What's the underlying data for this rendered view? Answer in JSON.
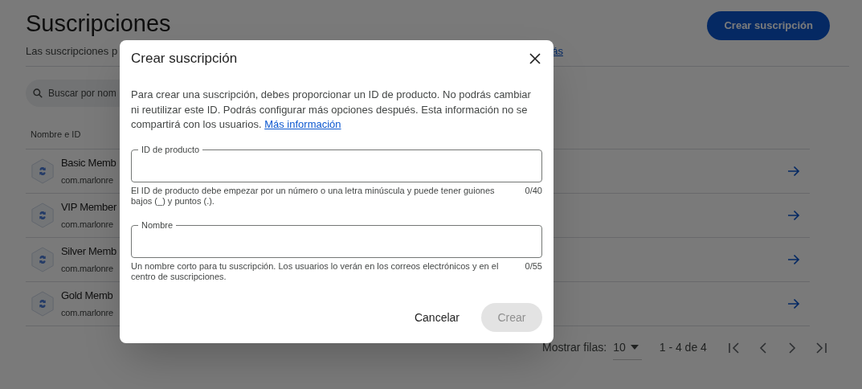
{
  "page": {
    "title": "Suscripciones",
    "subtitle": "Las suscripciones p",
    "subtitle_link": "ás",
    "create_button": "Crear suscripción",
    "search": {
      "placeholder": "Buscar por nom"
    },
    "table": {
      "columns": [
        "Nombre e ID"
      ],
      "rows": [
        {
          "name": "Basic Memb",
          "id": "com.marlonre"
        },
        {
          "name": "VIP Member",
          "id": "com.marlonre"
        },
        {
          "name": "Silver Memb",
          "id": "com.marlonre"
        },
        {
          "name": "Gold Memb",
          "id": "com.marlonre"
        }
      ]
    },
    "pagination": {
      "rows_label": "Mostrar filas:",
      "rows_per_page": "10",
      "range": "1 - 4 de 4"
    }
  },
  "dialog": {
    "title": "Crear suscripción",
    "description": "Para crear una suscripción, debes proporcionar un ID de producto. No podrás cambiar ni reutilizar este ID. Podrás configurar más opciones después. Esta información no se compartirá con los usuarios.",
    "link": "Más información",
    "fields": [
      {
        "label": "ID de producto",
        "helper": "El ID de producto debe empezar por un número o una letra minúscula y puede tener guiones bajos (_) y puntos (.).",
        "counter": "0/40"
      },
      {
        "label": "Nombre",
        "helper": "Un nombre corto para tu suscripción. Los usuarios lo verán en los correos electrónicos y en el centro de suscripciones.",
        "counter": "0/55"
      }
    ],
    "buttons": [
      {
        "label": "Cancelar",
        "disabled": false
      },
      {
        "label": "Crear",
        "disabled": true
      }
    ]
  }
}
